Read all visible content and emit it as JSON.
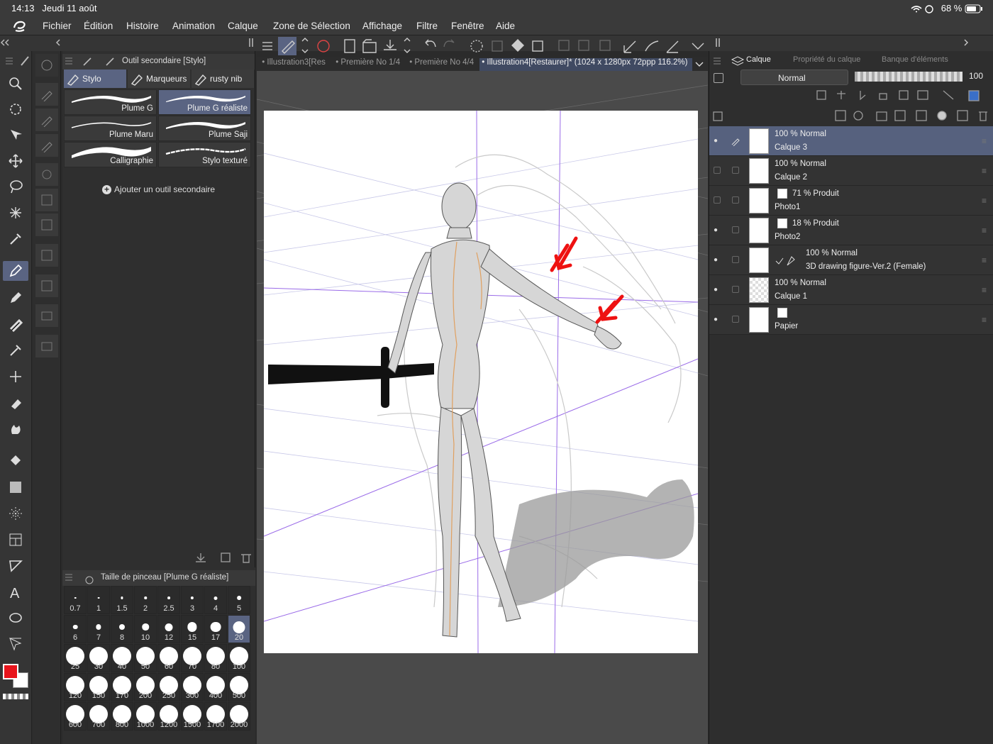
{
  "status": {
    "time": "14:13",
    "date": "Jeudi 11 août",
    "battery": "68 %"
  },
  "menu": [
    "Fichier",
    "Édition",
    "Histoire",
    "Animation",
    "Calque",
    "Zone de Sélection",
    "Affichage",
    "Filtre",
    "Fenêtre",
    "Aide"
  ],
  "sub_tool": {
    "title": "Outil secondaire [Stylo]",
    "tabs": [
      "Stylo",
      "Marqueurs",
      "rusty nib"
    ],
    "brushes": [
      "Plume G",
      "Plume G réaliste",
      "Plume Maru",
      "Plume Saji",
      "Calligraphie",
      "Stylo texturé"
    ],
    "add_label": "Ajouter un outil secondaire"
  },
  "brush_size": {
    "title": "Taille de pinceau [Plume G réaliste]",
    "sizes": [
      "0.7",
      "1",
      "1.5",
      "2",
      "2.5",
      "3",
      "4",
      "5",
      "6",
      "7",
      "8",
      "10",
      "12",
      "15",
      "17",
      "20",
      "25",
      "30",
      "40",
      "50",
      "60",
      "70",
      "80",
      "100",
      "120",
      "150",
      "170",
      "200",
      "250",
      "300",
      "400",
      "500",
      "600",
      "700",
      "800",
      "1000",
      "1200",
      "1500",
      "1700",
      "2000"
    ],
    "selected": "20"
  },
  "doc_tabs": [
    "Illustration3[Res",
    "Première No 1/4",
    "Première No 4/4",
    "Illustration4[Restaurer]* (1024 x 1280px 72ppp 116.2%)"
  ],
  "layer_panel": {
    "tabs": [
      "Calque",
      "Propriété du calque",
      "Banque d'éléments"
    ],
    "blend_mode": "Normal",
    "opacity": "100",
    "layers": [
      {
        "pct": "100 %",
        "mode": "Normal",
        "name": "Calque 3"
      },
      {
        "pct": "100 %",
        "mode": "Normal",
        "name": "Calque 2"
      },
      {
        "pct": "71 %",
        "mode": "Produit",
        "name": "Photo1"
      },
      {
        "pct": "18 %",
        "mode": "Produit",
        "name": "Photo2"
      },
      {
        "pct": "100 %",
        "mode": "Normal",
        "name": "3D drawing figure-Ver.2 (Female)"
      },
      {
        "pct": "100 %",
        "mode": "Normal",
        "name": "Calque 1"
      },
      {
        "pct": "",
        "mode": "",
        "name": "Papier"
      }
    ]
  },
  "colors": {
    "main": "#e8141c",
    "sub": "#ffffff",
    "accent": "#5a6482"
  }
}
